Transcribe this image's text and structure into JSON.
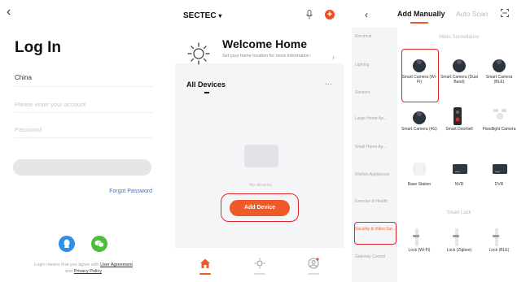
{
  "login": {
    "back": "‹",
    "title": "Log In",
    "country": "China",
    "account_placeholder": "Please enter your account",
    "password_placeholder": "Password",
    "forgot": "Forgot Password",
    "terms_prefix": "Login means that you agree with",
    "terms_agreement": "User Agreement",
    "terms_and": "and",
    "terms_privacy": "Privacy Policy",
    "colors": {
      "qq": "#2f8fe8",
      "wechat": "#4bbf3a"
    }
  },
  "home": {
    "brand": "SECTEC",
    "brand_caret": "▾",
    "welcome_title": "Welcome Home",
    "welcome_sub": "Set your home location for more information",
    "all_devices": "All Devices",
    "more": "···",
    "no_devices": "No devices",
    "add_device": "Add Device",
    "accent": "#f05a28"
  },
  "add": {
    "back": "‹",
    "tab_active": "Add Manually",
    "tab_inactive": "Auto Scan",
    "sidebar": [
      {
        "label": "Electrical",
        "active": false
      },
      {
        "label": "Lighting",
        "active": false
      },
      {
        "label": "Sensors",
        "active": false
      },
      {
        "label": "Large Home Ap...",
        "active": false
      },
      {
        "label": "Small Home Ap...",
        "active": false
      },
      {
        "label": "Kitchen Appliances",
        "active": false
      },
      {
        "label": "Exercise & Health",
        "active": false
      },
      {
        "label": "Security & Video Sur...",
        "active": true
      },
      {
        "label": "Gateway Control",
        "active": false
      }
    ],
    "section_video": "Video Surveillance",
    "section_lock": "Smart Lock",
    "devices": [
      {
        "label": "Smart Camera (Wi-Fi)",
        "icon": "camera-icon"
      },
      {
        "label": "Smart Camera (Dual Band)",
        "icon": "camera-icon"
      },
      {
        "label": "Smart Camera (BLE)",
        "icon": "camera-icon"
      },
      {
        "label": "Smart Camera (4G)",
        "icon": "camera-icon"
      },
      {
        "label": "Smart Doorbell",
        "icon": "doorbell-icon"
      },
      {
        "label": "Floodlight Camera",
        "icon": "floodlight-icon"
      },
      {
        "label": "Base Station",
        "icon": "base-station-icon"
      },
      {
        "label": "NVR",
        "icon": "nvr-icon"
      },
      {
        "label": "DVR",
        "icon": "dvr-icon"
      }
    ],
    "locks": [
      {
        "label": "Lock (Wi-Fi)",
        "icon": "lock-icon"
      },
      {
        "label": "Lock (Zigbee)",
        "icon": "lock-icon"
      },
      {
        "label": "Lock (BLE)",
        "icon": "lock-icon"
      }
    ]
  }
}
